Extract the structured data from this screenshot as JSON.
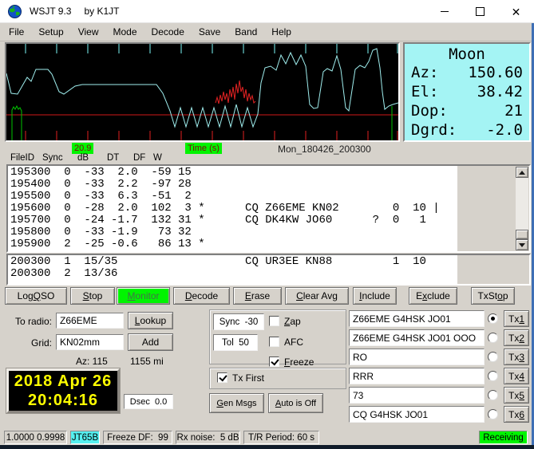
{
  "titlebar": {
    "title": "WSJT 9.3",
    "byline": "by K1JT"
  },
  "menu": {
    "items": [
      "File",
      "Setup",
      "View",
      "Mode",
      "Decode",
      "Save",
      "Band",
      "Help"
    ]
  },
  "graph": {
    "freq_label": "20.9",
    "time_label": "Time (s)",
    "file_label": "Mon_180426_200300"
  },
  "moon": {
    "title": "Moon",
    "rows": [
      {
        "label": "Az:",
        "value": "150.60"
      },
      {
        "label": "El:",
        "value": "38.42"
      },
      {
        "label": "Dop:",
        "value": "21"
      },
      {
        "label": "Dgrd:",
        "value": "-2.0"
      }
    ]
  },
  "decode_header": {
    "columns": [
      "FileID",
      "Sync",
      "dB",
      "DT",
      "DF",
      "W"
    ]
  },
  "decode_main": {
    "lines": [
      "195300  0  -33  2.0  -59 15",
      "195400  0  -33  2.2  -97 28",
      "195500  0  -33  6.3  -51  2",
      "195600  0  -28  2.0  102  3 *      CQ Z66EME KN02        0  10 |",
      "195700  0  -24 -1.7  132 31 *      CQ DK4KW JO60      ?  0   1",
      "195800  0  -33 -1.9   73 32",
      "195900  2  -25 -0.6   86 13 *"
    ]
  },
  "decode_avg": {
    "lines": [
      "200300  1  15/35                   CQ UR3EE KN88         1  10",
      "200300  2  13/36"
    ]
  },
  "action_buttons": [
    {
      "label": "Log QSO",
      "accel": "Q"
    },
    {
      "label": "Stop",
      "accel": "S"
    },
    {
      "label": "Monitor",
      "accel": "M"
    },
    {
      "label": "Decode",
      "accel": "D"
    },
    {
      "label": "Erase",
      "accel": "E"
    },
    {
      "label": "Clear Avg",
      "accel": "C"
    },
    {
      "label": "Include",
      "accel": "I"
    },
    {
      "label": "Exclude",
      "accel": "x"
    },
    {
      "label": "TxStop",
      "accel": "o"
    }
  ],
  "station": {
    "to_radio_label": "To radio:",
    "to_radio_value": "Z66EME",
    "grid_label": "Grid:",
    "grid_value": "KN02mm",
    "lookup": {
      "label": "Lookup",
      "accel": "L"
    },
    "add": {
      "label": "Add",
      "accel": ""
    },
    "azimuth": "Az: 115",
    "distance": "1155 mi"
  },
  "clock": {
    "date": "2018 Apr 26",
    "time": "20:04:16",
    "dsec": "Dsec  0.0"
  },
  "params": {
    "sync": "Sync  -30",
    "tol": "Tol  50",
    "zap": {
      "label": "Zap",
      "accel": "Z",
      "checked": false
    },
    "afc": {
      "label": "AFC",
      "accel": "",
      "checked": false
    },
    "freeze": {
      "label": "Freeze",
      "accel": "F",
      "checked": true
    },
    "tx_first": {
      "label": "Tx First",
      "accel": "",
      "checked": true
    },
    "gen_msgs": {
      "label": "Gen Msgs",
      "accel": "G"
    },
    "auto": {
      "label": "Auto is Off",
      "accel": "A"
    }
  },
  "tx": {
    "rows": [
      {
        "message": "Z66EME G4HSK JO01",
        "selected": true,
        "button": {
          "label": "Tx1",
          "accel": "1"
        }
      },
      {
        "message": "Z66EME G4HSK JO01 OOO",
        "selected": false,
        "button": {
          "label": "Tx2",
          "accel": "2"
        }
      },
      {
        "message": "RO",
        "selected": false,
        "button": {
          "label": "Tx3",
          "accel": "3"
        }
      },
      {
        "message": "RRR",
        "selected": false,
        "button": {
          "label": "Tx4",
          "accel": "4"
        }
      },
      {
        "message": "73",
        "selected": false,
        "button": {
          "label": "Tx5",
          "accel": "5"
        }
      },
      {
        "message": "CQ G4HSK JO01",
        "selected": false,
        "button": {
          "label": "Tx6",
          "accel": "6"
        }
      }
    ]
  },
  "statusbar": {
    "levels": "1.0000 0.9998",
    "mode": "JT65B",
    "freeze_df": "Freeze DF:  99",
    "rx_noise": "Rx noise:  5 dB",
    "tr_period": "T/R Period: 60 s",
    "state": "Receiving"
  },
  "colors": {
    "moon_bg": "#a4f4f4",
    "mode_bg": "#55f0f0",
    "green": "#00f400",
    "clock_text": "#ffff00",
    "label_text": "#7a0c0c"
  }
}
